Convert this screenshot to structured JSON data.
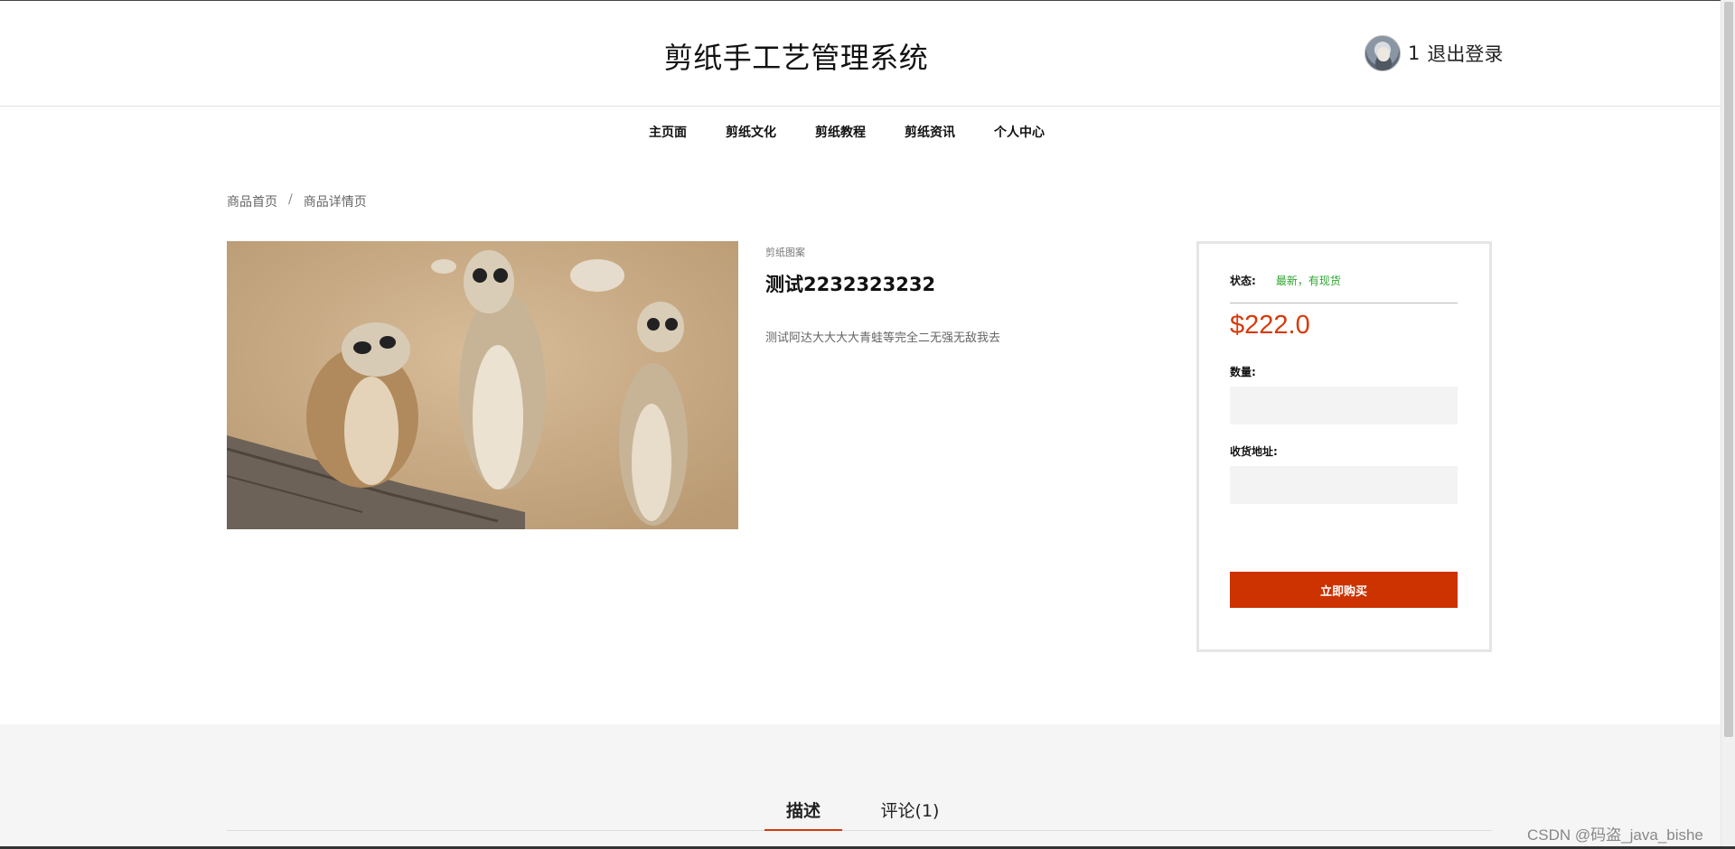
{
  "header": {
    "title": "剪纸手工艺管理系统",
    "user_name": "1",
    "logout_label": "退出登录"
  },
  "nav": {
    "items": [
      {
        "label": "主页面"
      },
      {
        "label": "剪纸文化"
      },
      {
        "label": "剪纸教程"
      },
      {
        "label": "剪纸资讯"
      },
      {
        "label": "个人中心"
      }
    ]
  },
  "breadcrumb": {
    "home": "商品首页",
    "separator": "/",
    "current": "商品详情页"
  },
  "product": {
    "category": "剪纸图案",
    "name": "测试2232323232",
    "description": "测试阿达大大大大青蛙等完全二无强无敌我去"
  },
  "purchase": {
    "status_label": "状态:",
    "status_value": "最新，有现货",
    "price": "$222.0",
    "quantity_label": "数量:",
    "quantity_value": "",
    "address_label": "收货地址:",
    "address_value": "",
    "buy_label": "立即购买"
  },
  "tabs": {
    "description_label": "描述",
    "comments_label": "评论(1)"
  },
  "watermark": "CSDN @码盗_java_bishe",
  "colors": {
    "accent": "#d53b0d",
    "buy_button": "#cc3300",
    "status_green": "#2ca52c"
  }
}
